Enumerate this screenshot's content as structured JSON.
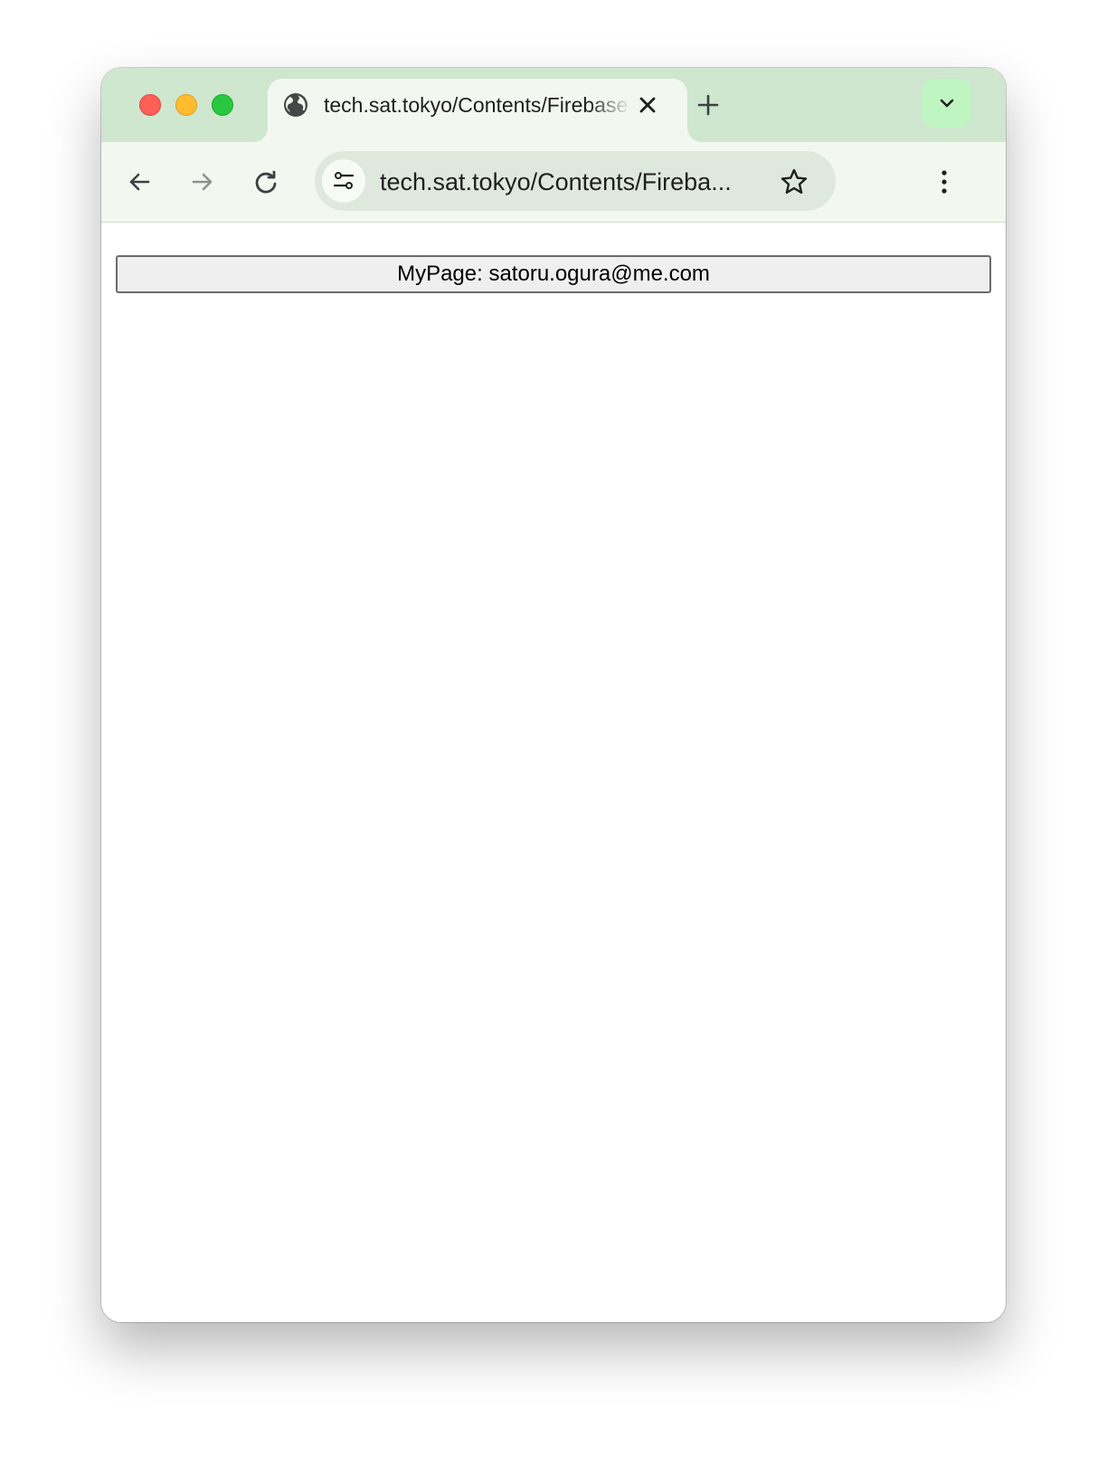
{
  "browser": {
    "tab": {
      "title": "tech.sat.tokyo/Contents/Firebase",
      "favicon": "globe-icon"
    },
    "address_bar": {
      "url": "tech.sat.tokyo/Contents/Fireba..."
    },
    "icons": {
      "back": "arrow-left-icon",
      "forward": "arrow-right-icon",
      "reload": "reload-icon",
      "site_info": "tune-icon",
      "bookmark": "star-icon",
      "menu": "more-vertical-icon",
      "new_tab": "plus-icon",
      "tab_close": "close-icon",
      "tab_search": "chevron-down-icon"
    },
    "colors": {
      "tabstrip": "#cfe6cf",
      "toolbar": "#f2f8ef",
      "omnibox": "#dfe8dc",
      "tab_search_bg": "#bff5c0",
      "traffic_close": "#fe5f57",
      "traffic_minimize": "#febc2e",
      "traffic_maximize": "#28c840"
    }
  },
  "page": {
    "mypage_button_label": "MyPage: satoru.ogura@me.com"
  }
}
